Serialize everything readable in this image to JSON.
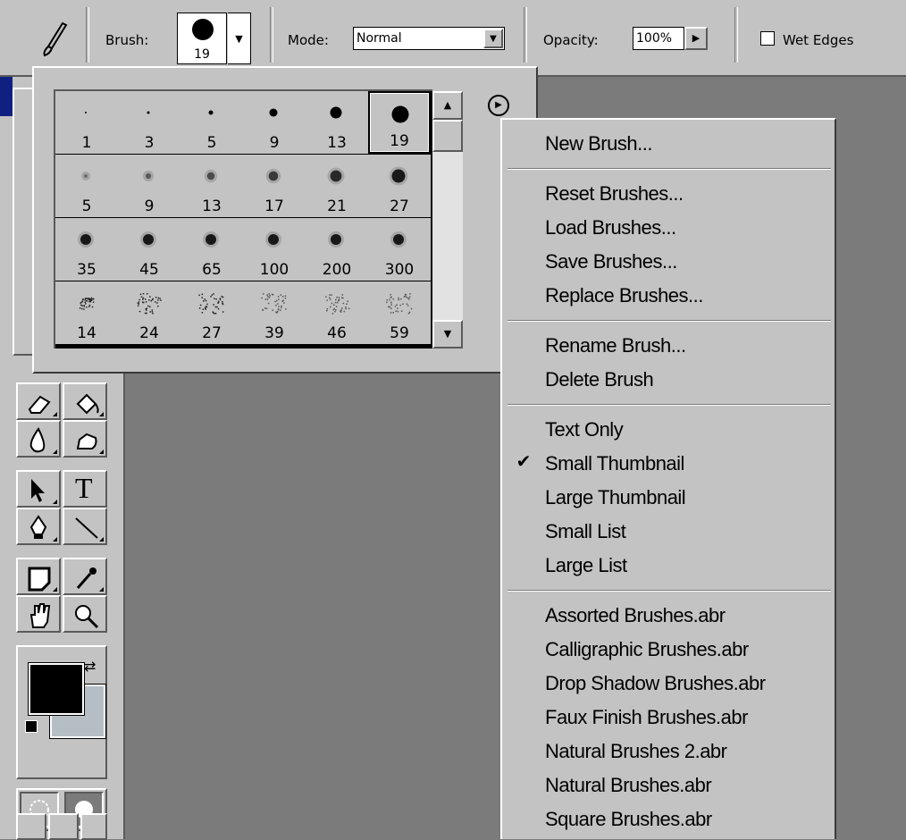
{
  "options_bar": {
    "brush_label": "Brush:",
    "brush_size": "19",
    "mode_label": "Mode:",
    "mode_value": "Normal",
    "opacity_label": "Opacity:",
    "opacity_value": "100%",
    "wet_edges_label": "Wet Edges",
    "wet_edges_checked": false
  },
  "brush_palette": {
    "rows": [
      [
        "1",
        "3",
        "5",
        "9",
        "13",
        "19"
      ],
      [
        "5",
        "9",
        "13",
        "17",
        "21",
        "27"
      ],
      [
        "35",
        "45",
        "65",
        "100",
        "200",
        "300"
      ],
      [
        "14",
        "24",
        "27",
        "39",
        "46",
        "59"
      ]
    ],
    "selected": "19"
  },
  "context_menu": {
    "new_brush": "New Brush...",
    "reset_brushes": "Reset Brushes...",
    "load_brushes": "Load Brushes...",
    "save_brushes": "Save Brushes...",
    "replace_brushes": "Replace Brushes...",
    "rename_brush": "Rename Brush...",
    "delete_brush": "Delete Brush",
    "text_only": "Text Only",
    "small_thumbnail": "Small Thumbnail",
    "large_thumbnail": "Large Thumbnail",
    "small_list": "Small List",
    "large_list": "Large List",
    "assorted": "Assorted Brushes.abr",
    "calligraphic": "Calligraphic Brushes.abr",
    "drop_shadow": "Drop Shadow Brushes.abr",
    "faux_finish": "Faux Finish Brushes.abr",
    "natural2": "Natural Brushes 2.abr",
    "natural": "Natural Brushes.abr",
    "square": "Square Brushes.abr",
    "checked_item": "Small Thumbnail",
    "check_glyph": "✔"
  },
  "toolbox": {
    "type_tool_glyph": "T",
    "foreground_color": "#000000",
    "background_color": "#b6bec5"
  }
}
